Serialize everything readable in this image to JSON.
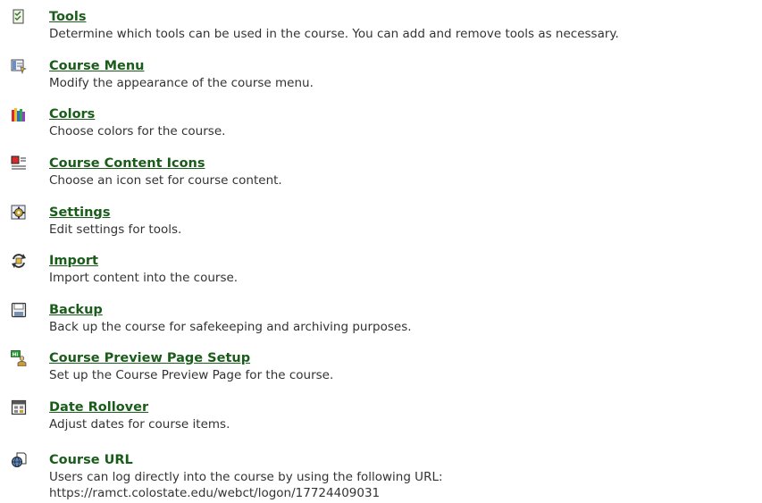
{
  "items": [
    {
      "title": "Tools",
      "description": "Determine which tools can be used in the course. You can add and remove tools as necessary.",
      "icon": "tools-icon"
    },
    {
      "title": "Course Menu",
      "description": "Modify the appearance of the course menu.",
      "icon": "course-menu-icon"
    },
    {
      "title": "Colors",
      "description": "Choose colors for the course.",
      "icon": "colors-icon"
    },
    {
      "title": "Course Content Icons",
      "description": "Choose an icon set for course content.",
      "icon": "content-icons-icon"
    },
    {
      "title": "Settings",
      "description": "Edit settings for tools.",
      "icon": "settings-icon"
    },
    {
      "title": "Import",
      "description": "Import content into the course.",
      "icon": "import-icon"
    },
    {
      "title": "Backup",
      "description": "Back up the course for safekeeping and archiving purposes.",
      "icon": "backup-icon"
    },
    {
      "title": "Course Preview Page Setup",
      "description": "Set up the Course Preview Page for the course.",
      "icon": "preview-page-icon"
    },
    {
      "title": "Date Rollover",
      "description": "Adjust dates for course items.",
      "icon": "calendar-icon"
    }
  ],
  "course_url": {
    "title": "Course URL",
    "description": "Users can log directly into the course by using the following URL:",
    "url": "https://ramct.colostate.edu/webct/logon/17724409031",
    "icon": "globe-page-icon"
  },
  "colors": {
    "link": "#1a5c1a",
    "text": "#333333"
  }
}
